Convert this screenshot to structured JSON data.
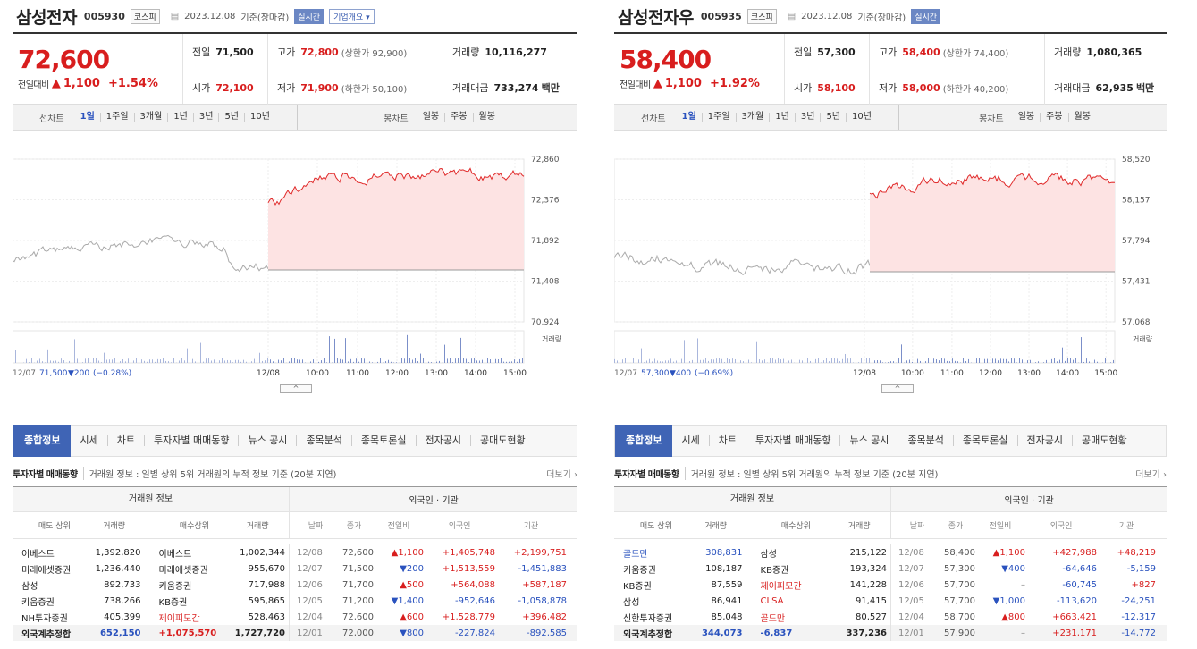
{
  "panels": [
    {
      "id": "left",
      "name": "삼성전자",
      "code": "005930",
      "market": "코스피",
      "date": "2023.12.08",
      "date_suffix": "기준(장마감)",
      "live": "실시간",
      "overview": "기업개요",
      "price": "72,600",
      "change_label": "전일대비",
      "change": "1,100",
      "change_pct": "+1.54%",
      "quote": {
        "prev_k": "전일",
        "prev_v": "71,500",
        "open_k": "시가",
        "open_v": "72,100",
        "high_k": "고가",
        "high_v": "72,800",
        "upper": "(상한가 92,900)",
        "low_k": "저가",
        "low_v": "71,900",
        "lower": "(하한가 50,100)",
        "vol_k": "거래량",
        "vol_v": "10,116,277",
        "amt_k": "거래대금",
        "amt_v": "733,274",
        "amt_unit": "백만"
      },
      "line_label": "선차트",
      "periods": [
        "1일",
        "1주일",
        "3개월",
        "1년",
        "3년",
        "5년",
        "10년"
      ],
      "candle_label": "봉차트",
      "candles": [
        "일봉",
        "주봉",
        "월봉"
      ],
      "chart": {
        "yticks": [
          "72,860",
          "72,376",
          "71,892",
          "71,408",
          "70,924"
        ],
        "xticks": [
          "12/08",
          "10:00",
          "11:00",
          "12:00",
          "13:00",
          "14:00",
          "15:00"
        ],
        "prev_date": "12/07",
        "prev_close": "71,500",
        "prev_change": "▼200",
        "prev_pct": "(−0.28%)",
        "volume_label": "거래량"
      },
      "tabs": [
        "종합정보",
        "시세",
        "차트",
        "투자자별 매매동향",
        "뉴스 공시",
        "종목분석",
        "종목토론실",
        "전자공시",
        "공매도현황"
      ],
      "section_title": "투자자별 매매동향",
      "section_desc": "거래원 정보 : 일별 상위 5위 거래원의 누적 정보 기준 (20분 지연)",
      "more": "더보기",
      "group_left": "거래원 정보",
      "group_right": "외국인 · 기관",
      "cols": [
        "매도 상위",
        "거래량",
        "매수상위",
        "거래량",
        "날짜",
        "종가",
        "전일비",
        "외국인",
        "기관"
      ],
      "rows": [
        {
          "sell": "이베스트",
          "sv": "1,392,820",
          "buy": "이베스트",
          "bv": "1,002,344",
          "date": "12/08",
          "close": "72,600",
          "diff": "▲1,100",
          "dir": "up",
          "foreign": "+1,405,748",
          "inst": "+2,199,751"
        },
        {
          "sell": "미래에셋증권",
          "sv": "1,236,440",
          "buy": "미래에셋증권",
          "bv": "955,670",
          "date": "12/07",
          "close": "71,500",
          "diff": "▼200",
          "dir": "down",
          "foreign": "+1,513,559",
          "inst": "-1,451,883"
        },
        {
          "sell": "삼성",
          "sv": "892,733",
          "buy": "키움증권",
          "bv": "717,988",
          "date": "12/06",
          "close": "71,700",
          "diff": "▲500",
          "dir": "up",
          "foreign": "+564,088",
          "inst": "+587,187"
        },
        {
          "sell": "키움증권",
          "sv": "738,266",
          "buy": "KB증권",
          "bv": "595,865",
          "date": "12/05",
          "close": "71,200",
          "diff": "▼1,400",
          "dir": "down",
          "foreign": "-952,646",
          "inst": "-1,058,878"
        },
        {
          "sell": "NH투자증권",
          "sv": "405,399",
          "buy": "제이피모간",
          "bv": "528,463",
          "date": "12/04",
          "close": "72,600",
          "diff": "▲600",
          "dir": "up",
          "foreign": "+1,528,779",
          "inst": "+396,482"
        }
      ],
      "total": {
        "label": "외국계추정합",
        "sv": "652,150",
        "buy": "+1,075,570",
        "bv": "1,727,720",
        "date": "12/01",
        "close": "72,000",
        "diff": "▼800",
        "dir": "down",
        "foreign": "-227,824",
        "inst": "-892,585"
      }
    },
    {
      "id": "right",
      "name": "삼성전자우",
      "code": "005935",
      "market": "코스피",
      "date": "2023.12.08",
      "date_suffix": "기준(장마감)",
      "live": "실시간",
      "overview": "",
      "price": "58,400",
      "change_label": "전일대비",
      "change": "1,100",
      "change_pct": "+1.92%",
      "quote": {
        "prev_k": "전일",
        "prev_v": "57,300",
        "open_k": "시가",
        "open_v": "58,100",
        "high_k": "고가",
        "high_v": "58,400",
        "upper": "(상한가 74,400)",
        "low_k": "저가",
        "low_v": "58,000",
        "lower": "(하한가 40,200)",
        "vol_k": "거래량",
        "vol_v": "1,080,365",
        "amt_k": "거래대금",
        "amt_v": "62,935",
        "amt_unit": "백만"
      },
      "line_label": "선차트",
      "periods": [
        "1일",
        "1주일",
        "3개월",
        "1년",
        "3년",
        "5년",
        "10년"
      ],
      "candle_label": "봉차트",
      "candles": [
        "일봉",
        "주봉",
        "월봉"
      ],
      "chart": {
        "yticks": [
          "58,520",
          "58,157",
          "57,794",
          "57,431",
          "57,068"
        ],
        "xticks": [
          "12/08",
          "10:00",
          "11:00",
          "12:00",
          "13:00",
          "14:00",
          "15:00"
        ],
        "prev_date": "12/07",
        "prev_close": "57,300",
        "prev_change": "▼400",
        "prev_pct": "(−0.69%)",
        "volume_label": "거래량"
      },
      "tabs": [
        "종합정보",
        "시세",
        "차트",
        "투자자별 매매동향",
        "뉴스 공시",
        "종목분석",
        "종목토론실",
        "전자공시",
        "공매도현황"
      ],
      "section_title": "투자자별 매매동향",
      "section_desc": "거래원 정보 : 일별 상위 5위 거래원의 누적 정보 기준 (20분 지연)",
      "more": "더보기",
      "group_left": "거래원 정보",
      "group_right": "외국인 · 기관",
      "cols": [
        "매도 상위",
        "거래량",
        "매수상위",
        "거래량",
        "날짜",
        "종가",
        "전일비",
        "외국인",
        "기관"
      ],
      "rows": [
        {
          "sell": "골드만",
          "sv": "308,831",
          "buy": "삼성",
          "bv": "215,122",
          "date": "12/08",
          "close": "58,400",
          "diff": "▲1,100",
          "dir": "up",
          "foreign": "+427,988",
          "inst": "+48,219"
        },
        {
          "sell": "키움증권",
          "sv": "108,187",
          "buy": "KB증권",
          "bv": "193,324",
          "date": "12/07",
          "close": "57,300",
          "diff": "▼400",
          "dir": "down",
          "foreign": "-64,646",
          "inst": "-5,159"
        },
        {
          "sell": "KB증권",
          "sv": "87,559",
          "buy": "제이피모간",
          "bv": "141,228",
          "date": "12/06",
          "close": "57,700",
          "diff": "–",
          "dir": "flat",
          "foreign": "-60,745",
          "inst": "+827"
        },
        {
          "sell": "삼성",
          "sv": "86,941",
          "buy": "CLSA",
          "bv": "91,415",
          "date": "12/05",
          "close": "57,700",
          "diff": "▼1,000",
          "dir": "down",
          "foreign": "-113,620",
          "inst": "-24,251"
        },
        {
          "sell": "신한투자증권",
          "sv": "85,048",
          "buy": "골드만",
          "bv": "80,527",
          "date": "12/04",
          "close": "58,700",
          "diff": "▲800",
          "dir": "up",
          "foreign": "+663,421",
          "inst": "-12,317"
        }
      ],
      "total": {
        "label": "외국계추정합",
        "sv": "344,073",
        "buy": "-6,837",
        "bv": "337,236",
        "date": "12/01",
        "close": "57,900",
        "diff": "–",
        "dir": "flat",
        "foreign": "+231,171",
        "inst": "-14,772"
      }
    }
  ],
  "colors": {
    "up": "#d81e1e",
    "down": "#2a52be",
    "accent": "#3f64b5"
  }
}
